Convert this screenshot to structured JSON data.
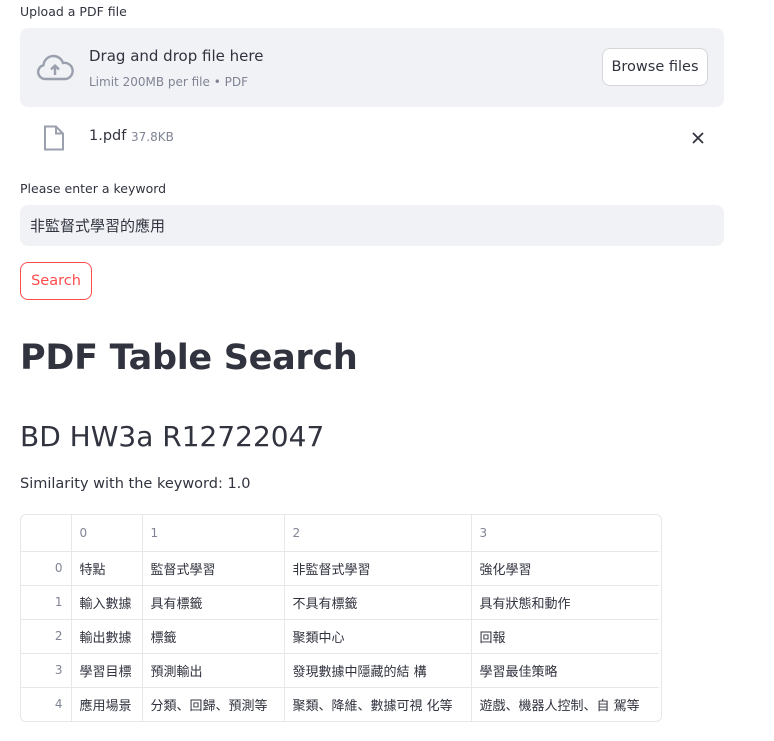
{
  "uploader": {
    "label": "Upload a PDF file",
    "drop_title": "Drag and drop file here",
    "drop_subtitle": "Limit 200MB per file • PDF",
    "browse_label": "Browse files"
  },
  "file": {
    "name": "1.pdf",
    "size": "37.8KB"
  },
  "keyword": {
    "label": "Please enter a keyword",
    "value": "非監督式學習的應用"
  },
  "search_button": "Search",
  "title": "PDF Table Search",
  "subtitle": "BD HW3a R12722047",
  "similarity": "Similarity with the keyword: 1.0",
  "table": {
    "columns": [
      "0",
      "1",
      "2",
      "3"
    ],
    "rows": [
      {
        "index": "0",
        "cells": [
          "特點",
          "監督式學習",
          "非監督式學習",
          "強化學習"
        ]
      },
      {
        "index": "1",
        "cells": [
          "輸入數據",
          "具有標籤",
          "不具有標籤",
          "具有狀態和動作"
        ]
      },
      {
        "index": "2",
        "cells": [
          "輸出數據",
          "標籤",
          "聚類中心",
          "回報"
        ]
      },
      {
        "index": "3",
        "cells": [
          "學習目標",
          "預測輸出",
          "發現數據中隱藏的結 構",
          "學習最佳策略"
        ]
      },
      {
        "index": "4",
        "cells": [
          "應用場景",
          "分類、回歸、預測等",
          "聚類、降維、數據可視 化等",
          "遊戲、機器人控制、自 駕等"
        ]
      }
    ]
  },
  "colors": {
    "accent": "#ff4b4b",
    "panel": "#f0f2f6",
    "muted": "#808495",
    "text": "#31333f"
  }
}
